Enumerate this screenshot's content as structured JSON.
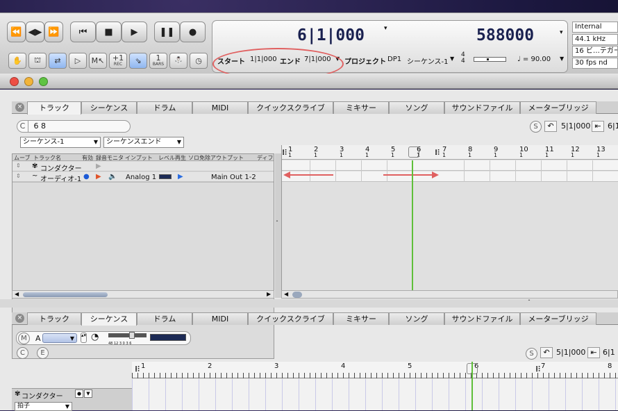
{
  "transport": {
    "buttons": [
      "⏪",
      "◀▶",
      "⏩",
      "⏮",
      "■",
      "▶",
      "❚❚",
      "●"
    ],
    "small_buttons": [
      {
        "icon": "✋",
        "label": ""
      },
      {
        "icon": "⛫",
        "label": ""
      },
      {
        "icon": "⇄",
        "label": ""
      },
      {
        "icon": "▷",
        "label": ""
      },
      {
        "icon": "M↖",
        "label": ""
      },
      {
        "icon": "+1",
        "label": "REC"
      },
      {
        "icon": "⇘",
        "label": ""
      },
      {
        "icon": "1",
        "label": "BARS"
      },
      {
        "icon": "⛄",
        "label": ""
      },
      {
        "icon": "◷",
        "label": ""
      }
    ],
    "counter_main": "6|1|000",
    "counter_secondary": "588000",
    "start_label": "スタート",
    "start_value": "1|1|000",
    "end_label": "エンド",
    "end_value": "7|1|000",
    "project_label": "プロジェクト",
    "project_value": "DP1",
    "sequence_value": "シーケンス-1",
    "meter_top": "4",
    "meter_bottom": "4",
    "tempo_text": "♩ = 90.00",
    "right_info": [
      "Internal",
      "44.1 kHz",
      "16 ビ…テガー",
      "30 fps nd"
    ]
  },
  "tabs": [
    "トラック",
    "シーケンス",
    "ドラム",
    "MIDI",
    "クイックスクライブ",
    "ミキサー",
    "ソング",
    "サウンドファイル",
    "メーターブリッジ"
  ],
  "track_panel": {
    "search_prefix": "C",
    "search_value": "6      8",
    "sequence_select": "シーケンス-1",
    "end_select": "シーケンスエンド",
    "s_button": "S",
    "loc_value": "5|1|000",
    "loc_value2": "6|1",
    "columns": [
      "ムーブ",
      "トラック名",
      "有効",
      "録音",
      "モニタ",
      "インプット",
      "レベル",
      "再生",
      "ソロ免除",
      "アウトプット",
      "ディフ"
    ],
    "rows": [
      {
        "name": "コンダクター",
        "input": "",
        "output": ""
      },
      {
        "name": "オーディオ-1",
        "input": "Analog 1",
        "output": "Main Out 1-2"
      }
    ],
    "ruler_bars": [
      "1",
      "2",
      "3",
      "4",
      "5",
      "6",
      "7",
      "8",
      "9",
      "10",
      "11",
      "12",
      "13"
    ],
    "ruler_beat": "1"
  },
  "sequence_panel": {
    "m_button": "M",
    "track_letter": "A",
    "c_button": "C",
    "e_button": "E",
    "s_button": "S",
    "loc_value": "5|1|000",
    "loc_value2": "6|1",
    "meter_ticks": "48  12   3 0 3 6",
    "ruler_bars": [
      "1",
      "2",
      "3",
      "4",
      "5",
      "6",
      "7",
      "8"
    ],
    "conductor": "コンダクター",
    "beat_select": "拍子"
  }
}
